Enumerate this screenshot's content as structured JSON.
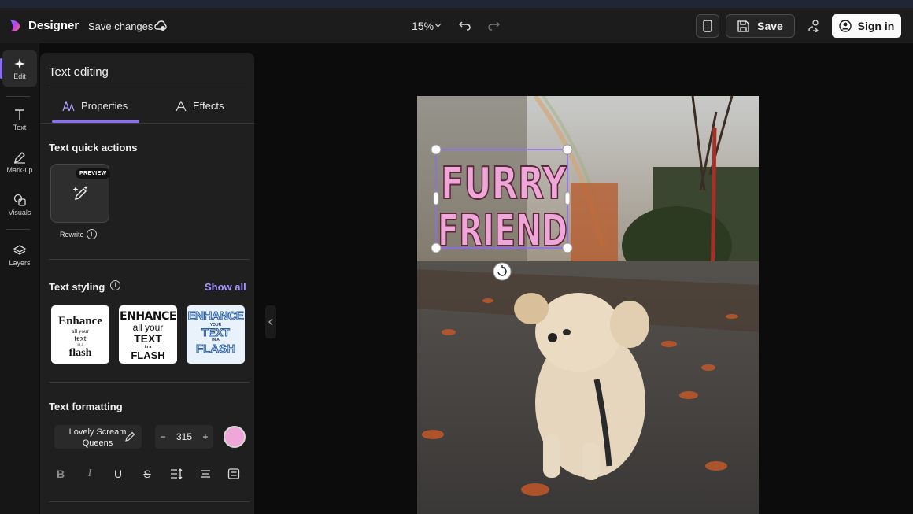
{
  "app": {
    "name": "Designer",
    "save_status": "Save changes"
  },
  "toolbar": {
    "zoom": "15%",
    "save_label": "Save",
    "signin_label": "Sign in"
  },
  "rail": {
    "items": [
      {
        "label": "Edit",
        "icon": "sparkle-icon",
        "active": true
      },
      {
        "label": "Text",
        "icon": "text-icon"
      },
      {
        "label": "Mark-up",
        "icon": "pen-icon"
      },
      {
        "label": "Visuals",
        "icon": "shapes-icon"
      },
      {
        "label": "Layers",
        "icon": "layers-icon"
      }
    ]
  },
  "panel": {
    "title": "Text editing",
    "tabs": [
      {
        "label": "Properties",
        "active": true
      },
      {
        "label": "Effects"
      }
    ],
    "quick_actions": {
      "title": "Text quick actions",
      "badge": "PREVIEW",
      "rewrite_label": "Rewrite"
    },
    "styling": {
      "title": "Text styling",
      "show_all": "Show all",
      "cards": [
        {
          "lines": [
            "Enhance",
            "all your",
            "text",
            "in a",
            "flash"
          ]
        },
        {
          "lines": [
            "ENHANCE",
            "all your",
            "TEXT",
            "in a",
            "FLASH"
          ]
        },
        {
          "lines": [
            "ENHANCE",
            "YOUR",
            "TEXT",
            "IN A",
            "FLASH"
          ]
        }
      ]
    },
    "formatting": {
      "title": "Text formatting",
      "font_name": "Lovely Scream Queens",
      "font_size": "315",
      "color": "#efa6d8",
      "buttons": [
        "bold-icon",
        "italic-icon",
        "underline-icon",
        "strikethrough-icon",
        "line-spacing-icon",
        "align-icon",
        "list-icon"
      ]
    }
  },
  "canvas": {
    "headline": [
      "FURRY",
      "FRIEND"
    ],
    "accent": "#8b6cf7"
  }
}
